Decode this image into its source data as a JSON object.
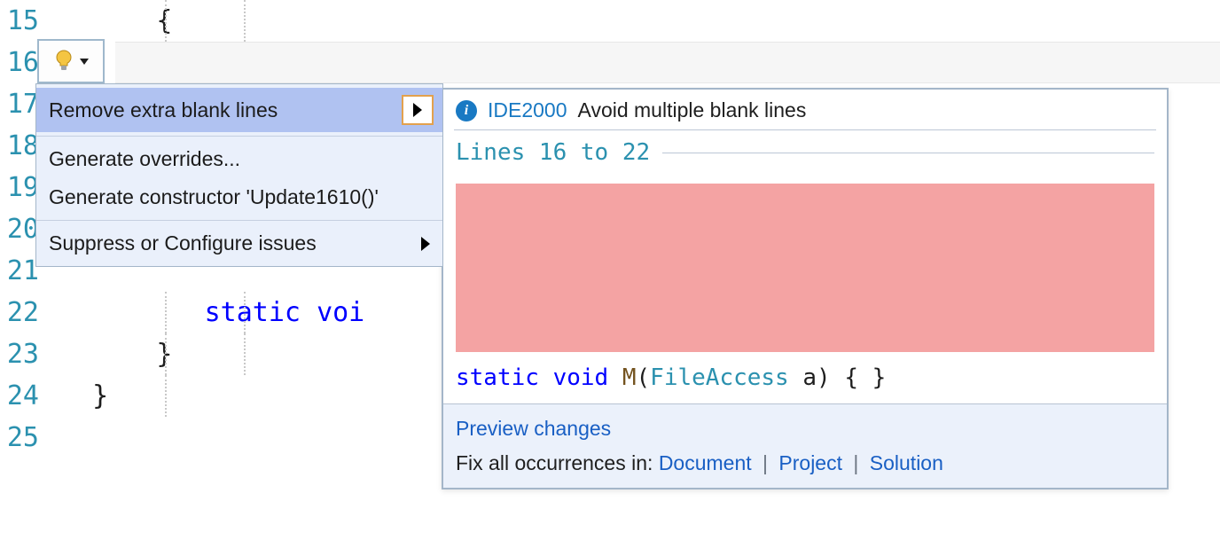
{
  "editor": {
    "lines": [
      {
        "num": "15",
        "text": "       {"
      },
      {
        "num": "16",
        "text": ""
      },
      {
        "num": "17",
        "text": ""
      },
      {
        "num": "18",
        "text": ""
      },
      {
        "num": "19",
        "text": ""
      },
      {
        "num": "20",
        "text": ""
      },
      {
        "num": "21",
        "text": ""
      },
      {
        "num": "22",
        "text": "          static voi"
      },
      {
        "num": "23",
        "text": "       }"
      },
      {
        "num": "24",
        "text": "   }"
      },
      {
        "num": "25",
        "text": ""
      }
    ]
  },
  "menu": {
    "items": [
      {
        "label": "Remove extra blank lines",
        "submenu": true,
        "selected": true
      },
      {
        "label": "Generate overrides...",
        "submenu": false
      },
      {
        "label": "Generate constructor 'Update1610()'",
        "submenu": false
      },
      {
        "label": "Suppress or Configure issues",
        "submenu": true
      }
    ]
  },
  "preview": {
    "code": "IDE2000",
    "title": "Avoid multiple blank lines",
    "range_label": "Lines 16 to 22",
    "code_tokens": {
      "kw_static": "static",
      "kw_void": "void",
      "method": "M",
      "type": "FileAccess",
      "param": "a",
      "after": ") { }"
    },
    "footer": {
      "preview_link": "Preview changes",
      "fix_label": "Fix all occurrences in:",
      "doc": "Document",
      "proj": "Project",
      "sol": "Solution"
    }
  }
}
